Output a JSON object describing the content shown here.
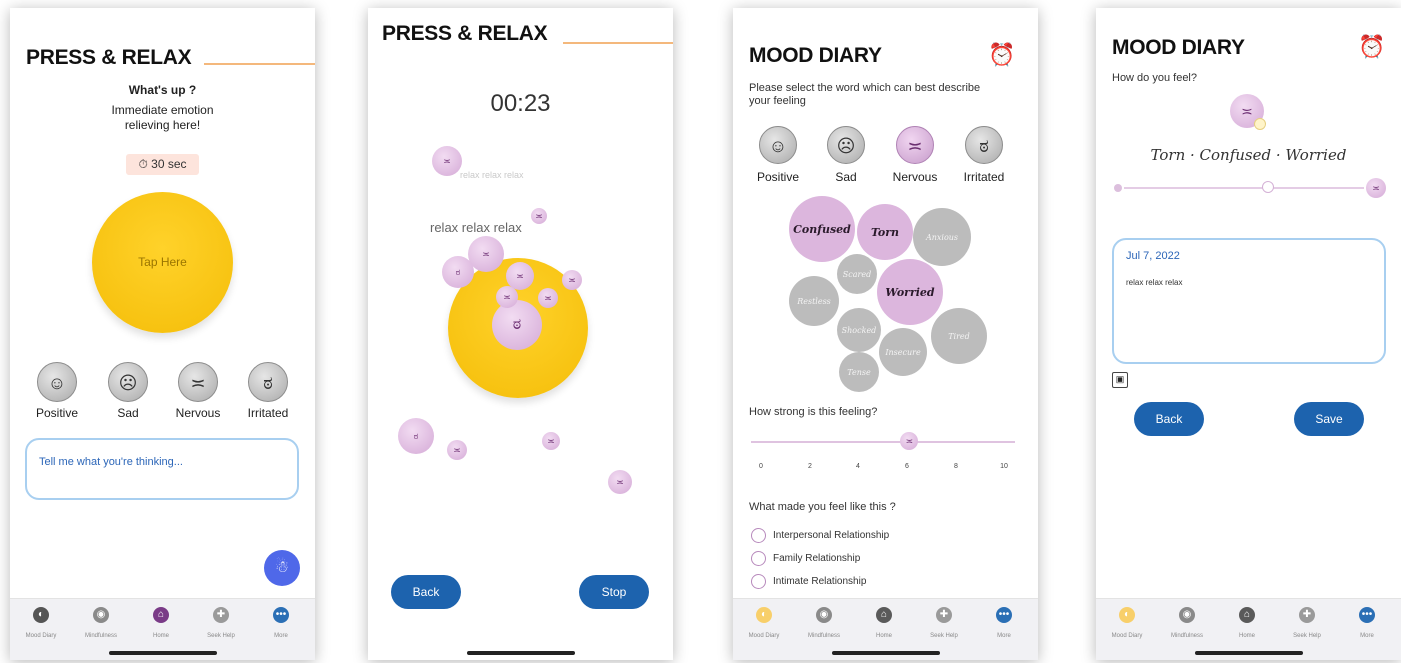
{
  "screen1": {
    "title": "PRESS & RELAX",
    "heading": "What's up ?",
    "subheading": "Immediate emotion relieving here!",
    "timer_badge": "⏱ 30 sec",
    "tap_label": "Tap Here",
    "moods": [
      {
        "label": "Positive",
        "glyph": "☺"
      },
      {
        "label": "Sad",
        "glyph": "☹"
      },
      {
        "label": "Nervous",
        "glyph": "≍"
      },
      {
        "label": "Irritated",
        "glyph": "ಠ"
      }
    ],
    "thought_placeholder": "Tell me what you're thinking...",
    "nav": [
      "Mood Diary",
      "Mindfulness",
      "Home",
      "Seek Help",
      "More"
    ]
  },
  "screen2": {
    "title": "PRESS & RELAX",
    "timer": "00:23",
    "faint_text": "relax relax relax",
    "relax_text": "relax relax relax",
    "back_label": "Back",
    "stop_label": "Stop"
  },
  "screen3": {
    "title": "MOOD DIARY",
    "prompt": "Please select the word which can best describe your feeling",
    "moods": [
      {
        "label": "Positive",
        "glyph": "☺"
      },
      {
        "label": "Sad",
        "glyph": "☹"
      },
      {
        "label": "Nervous",
        "glyph": "≍"
      },
      {
        "label": "Irritated",
        "glyph": "ಠ"
      }
    ],
    "feelings_selected": [
      "Confused",
      "Torn",
      "Worried"
    ],
    "feelings_other": [
      "Anxious",
      "Scared",
      "Restless",
      "Shocked",
      "Tired",
      "Insecure",
      "Tense"
    ],
    "strength_question": "How strong is this feeling?",
    "strength_value": 6,
    "strength_ticks": [
      "0",
      "2",
      "4",
      "6",
      "8",
      "10"
    ],
    "cause_question": "What made you feel like this ?",
    "causes": [
      "Interpersonal Relationship",
      "Family Relationship",
      "Intimate Relationship"
    ],
    "nav": [
      "Mood Diary",
      "Mindfulness",
      "Home",
      "Seek Help",
      "More"
    ]
  },
  "screen4": {
    "title": "MOOD DIARY",
    "prompt": "How do you feel?",
    "feelings_line": "Torn · Confused · Worried",
    "slider_fraction": 0.6,
    "entry_date": "Jul 7, 2022",
    "entry_text": "relax relax relax",
    "back_label": "Back",
    "save_label": "Save",
    "nav": [
      "Mood Diary",
      "Mindfulness",
      "Home",
      "Seek Help",
      "More"
    ]
  },
  "colors": {
    "accent_orange": "#f4b87c",
    "tap_yellow": "#f9c910",
    "mood_purple": "#d6abd8",
    "button_blue": "#1d63ae",
    "input_border": "#a8cff0"
  }
}
